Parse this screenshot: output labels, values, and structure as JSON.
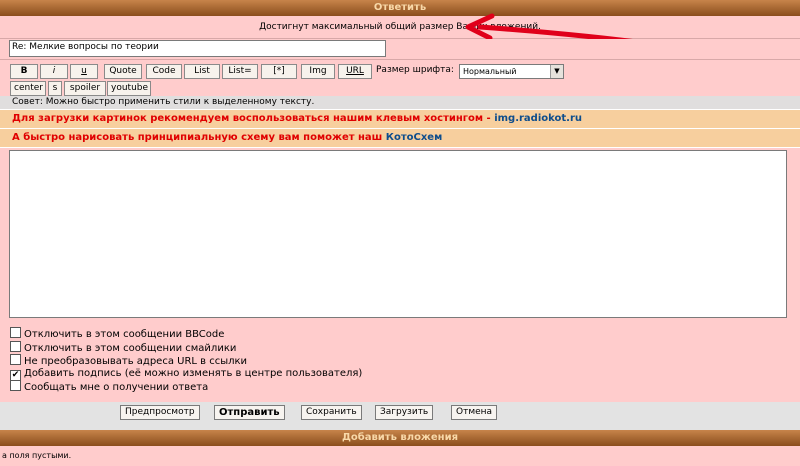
{
  "header_reply": "Ответить",
  "notice": "Достигнут максимальный общий размер Ваших вложений.",
  "subject": "Re: Мелкие вопросы по теории",
  "toolbar": {
    "bold": "B",
    "italic": "i",
    "underline": "u",
    "quote": "Quote",
    "code": "Code",
    "list": "List",
    "list_eq": "List=",
    "list_item": "[*]",
    "img": "Img",
    "url": "URL",
    "center": "center",
    "strike": "s",
    "spoiler": "spoiler",
    "youtube": "youtube",
    "font_size_label": "Размер шрифта:",
    "font_size_value": "Нормальный"
  },
  "tip": "Совет: Можно быстро применить стили к выделенному тексту.",
  "promo1": {
    "text": "Для загрузки картинок рекомендуем воспользоваться нашим клевым хостингом - ",
    "link": "img.radiokot.ru"
  },
  "promo2": {
    "text": "А быстро нарисовать принципиальную схему вам поможет наш ",
    "link": "КотоСхем"
  },
  "options": [
    {
      "label": "Отключить в этом сообщении BBCode",
      "checked": false
    },
    {
      "label": "Отключить в этом сообщении смайлики",
      "checked": false
    },
    {
      "label": "Не преобразовывать адреса URL в ссылки",
      "checked": false
    },
    {
      "label": "Добавить подпись (её можно изменять в центре пользователя)",
      "checked": true
    },
    {
      "label": "Сообщать мне о получении ответа",
      "checked": false
    }
  ],
  "actions": {
    "preview": "Предпросмотр",
    "submit": "Отправить",
    "save": "Сохранить",
    "load": "Загрузить",
    "cancel": "Отмена"
  },
  "header_attach": "Добавить вложения",
  "footer": "а поля пустыми.",
  "colors": {
    "arrow": "#e0001a",
    "header_bg": "#a8602a",
    "panel_bg": "#ffcccc",
    "promo_bg": "#f7cf9e"
  }
}
